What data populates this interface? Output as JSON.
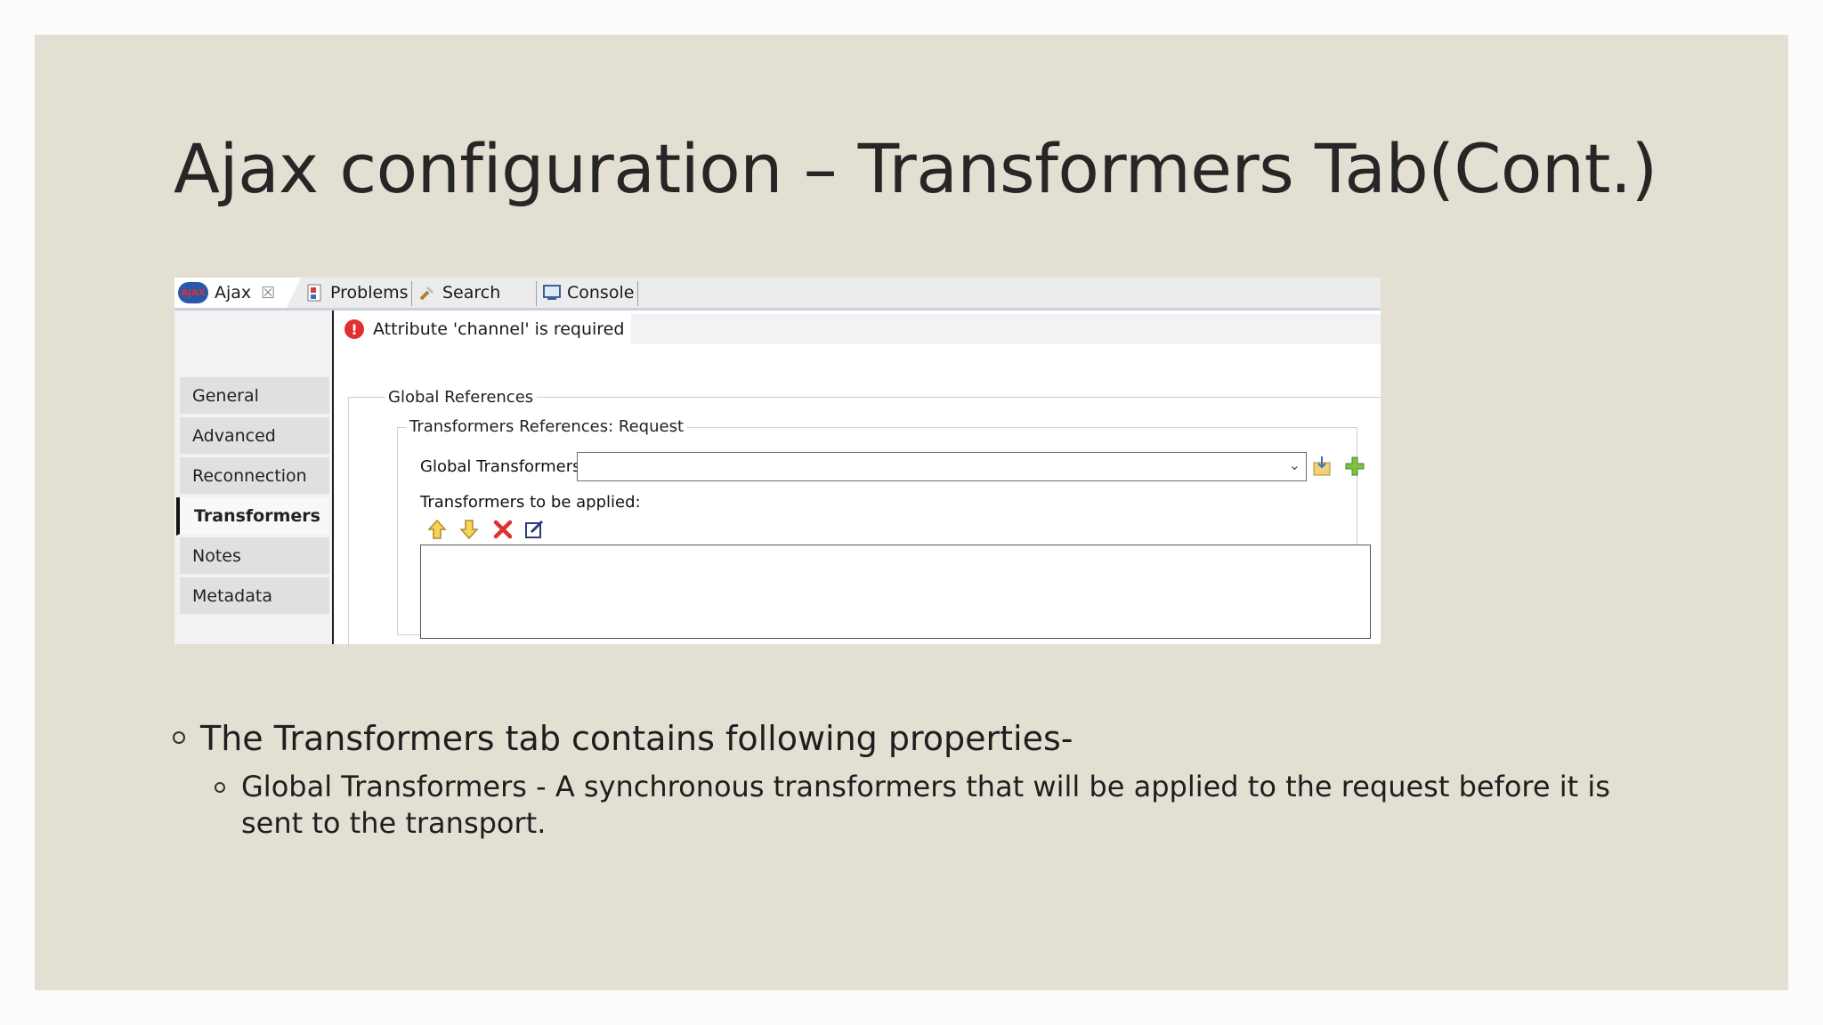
{
  "slide": {
    "title": "Ajax configuration – Transformers Tab(Cont.)"
  },
  "editor": {
    "tabs": [
      {
        "label": "Ajax",
        "icon": "ajax-icon",
        "closable": true,
        "active": true
      },
      {
        "label": "Problems",
        "icon": "problems-icon"
      },
      {
        "label": "Search",
        "icon": "search-icon"
      },
      {
        "label": "Console",
        "icon": "console-icon"
      }
    ],
    "sidebar": [
      "General",
      "Advanced",
      "Reconnection",
      "Transformers",
      "Notes",
      "Metadata"
    ],
    "selected_sidebar": "Transformers",
    "error_message": "Attribute 'channel' is required",
    "group_global": "Global References",
    "group_request": "Transformers References: Request",
    "global_transformers_label": "Global Transformers:",
    "global_transformers_value": "",
    "to_apply_label": "Transformers to be applied:",
    "accent": "#e03030"
  },
  "bullets": {
    "level1": "The Transformers tab contains following properties-",
    "level2": "Global Transformers - A synchronous transformers that will be applied to the request before it is sent to the transport."
  }
}
